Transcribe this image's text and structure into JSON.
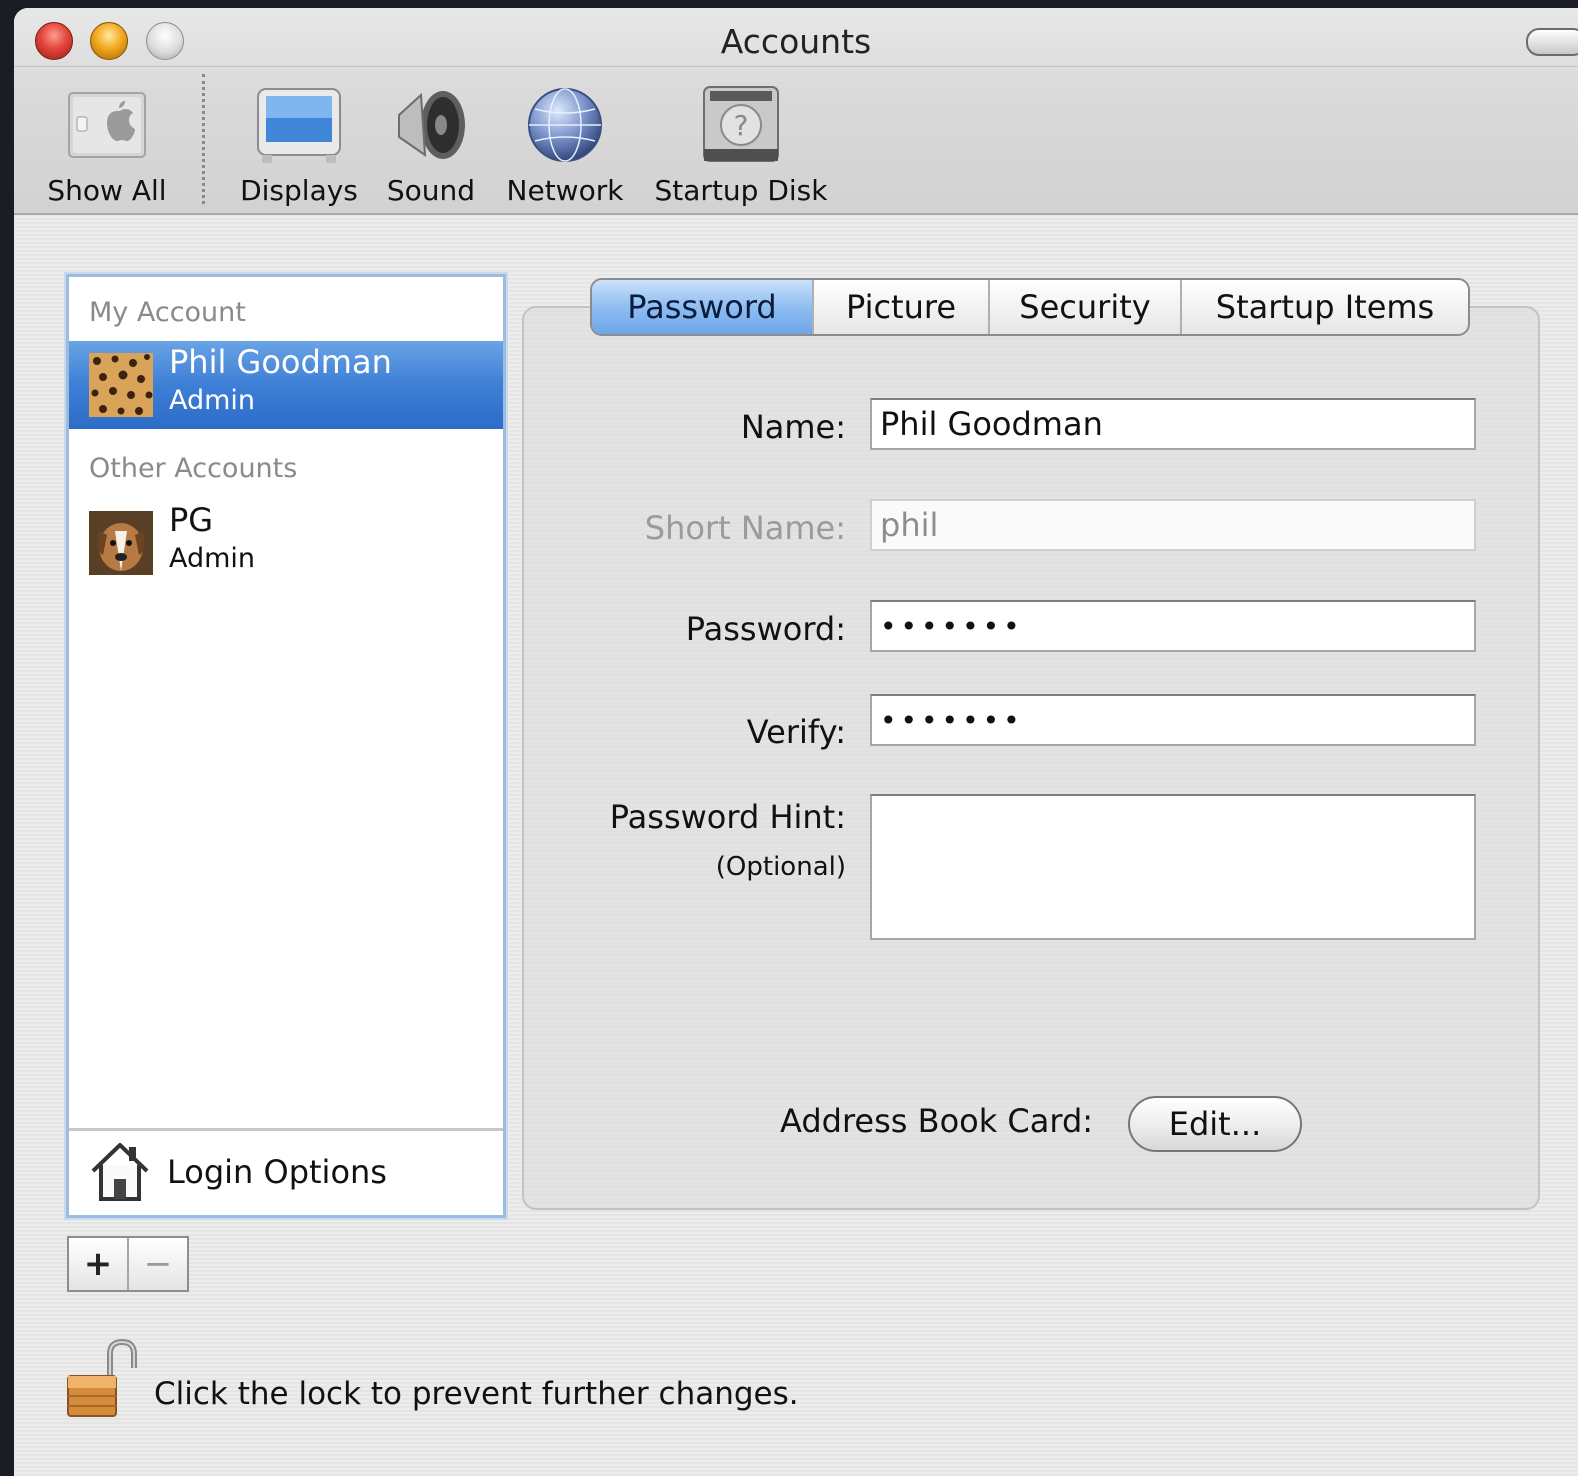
{
  "window": {
    "title": "Accounts"
  },
  "toolbar": {
    "items": [
      {
        "label": "Show All",
        "icon": "apple-switch-icon"
      },
      {
        "label": "Displays",
        "icon": "display-icon"
      },
      {
        "label": "Sound",
        "icon": "speaker-icon"
      },
      {
        "label": "Network",
        "icon": "globe-icon"
      },
      {
        "label": "Startup Disk",
        "icon": "hard-disk-icon"
      }
    ]
  },
  "accounts": {
    "my_account_header": "My Account",
    "other_accounts_header": "Other Accounts",
    "my_account": {
      "name": "Phil Goodman",
      "role": "Admin"
    },
    "others": [
      {
        "name": "PG",
        "role": "Admin"
      }
    ],
    "login_options": "Login Options",
    "add_symbol": "+",
    "remove_symbol": "−"
  },
  "tabs": [
    {
      "label": "Password",
      "active": true
    },
    {
      "label": "Picture",
      "active": false
    },
    {
      "label": "Security",
      "active": false
    },
    {
      "label": "Startup Items",
      "active": false
    }
  ],
  "form": {
    "name_label": "Name:",
    "name_value": "Phil Goodman",
    "short_name_label": "Short Name:",
    "short_name_value": "phil",
    "password_label": "Password:",
    "password_value": "•••••••",
    "verify_label": "Verify:",
    "verify_value": "•••••••",
    "hint_label": "Password Hint:",
    "hint_optional": "(Optional)",
    "hint_value": "",
    "address_book_label": "Address Book Card:",
    "edit_button": "Edit..."
  },
  "lock": {
    "text": "Click the lock to prevent further changes."
  },
  "colors": {
    "selection": "#3e7fd6",
    "active_tab": "#8fbdf1",
    "panel_border": "#9dbcdd"
  }
}
